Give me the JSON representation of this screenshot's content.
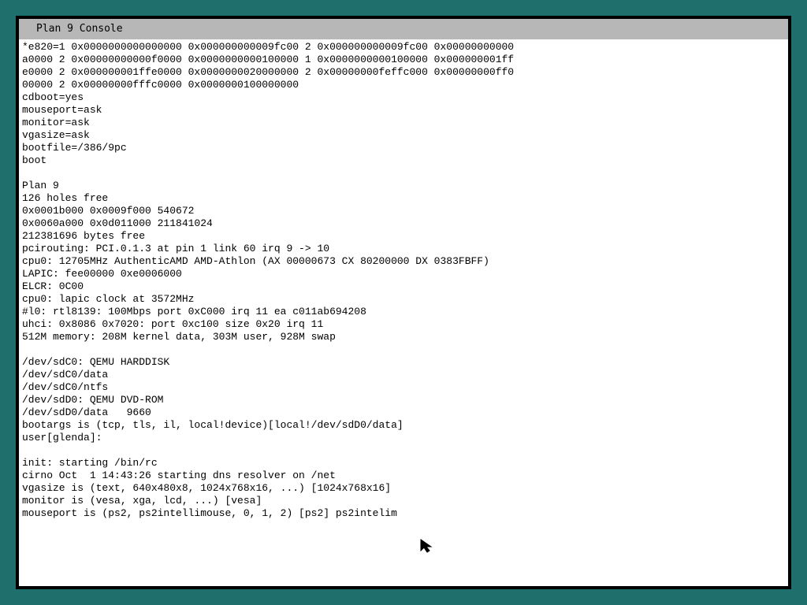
{
  "window": {
    "title": "Plan 9 Console"
  },
  "console": {
    "lines": [
      "*e820=1 0x0000000000000000 0x000000000009fc00 2 0x000000000009fc00 0x00000000000",
      "a0000 2 0x00000000000f0000 0x0000000000100000 1 0x0000000000100000 0x000000001ff",
      "e0000 2 0x000000001ffe0000 0x0000000020000000 2 0x00000000feffc000 0x00000000ff0",
      "00000 2 0x00000000fffc0000 0x0000000100000000",
      "cdboot=yes",
      "mouseport=ask",
      "monitor=ask",
      "vgasize=ask",
      "bootfile=/386/9pc",
      "boot",
      "",
      "Plan 9",
      "126 holes free",
      "0x0001b000 0x0009f000 540672",
      "0x0060a000 0x0d011000 211841024",
      "212381696 bytes free",
      "pcirouting: PCI.0.1.3 at pin 1 link 60 irq 9 -> 10",
      "cpu0: 12705MHz AuthenticAMD AMD-Athlon (AX 00000673 CX 80200000 DX 0383FBFF)",
      "LAPIC: fee00000 0xe0006000",
      "ELCR: 0C00",
      "cpu0: lapic clock at 3572MHz",
      "#l0: rtl8139: 100Mbps port 0xC000 irq 11 ea c011ab694208",
      "uhci: 0x8086 0x7020: port 0xc100 size 0x20 irq 11",
      "512M memory: 208M kernel data, 303M user, 928M swap",
      "",
      "/dev/sdC0: QEMU HARDDISK",
      "/dev/sdC0/data",
      "/dev/sdC0/ntfs",
      "/dev/sdD0: QEMU DVD-ROM",
      "/dev/sdD0/data   9660",
      "bootargs is (tcp, tls, il, local!device)[local!/dev/sdD0/data]",
      "user[glenda]:",
      "",
      "init: starting /bin/rc",
      "cirno Oct  1 14:43:26 starting dns resolver on /net",
      "vgasize is (text, 640x480x8, 1024x768x16, ...) [1024x768x16]",
      "monitor is (vesa, xga, lcd, ...) [vesa]",
      "mouseport is (ps2, ps2intellimouse, 0, 1, 2) [ps2] ps2intelim"
    ]
  },
  "icons": {
    "cursor": "mouse-pointer-icon"
  },
  "colors": {
    "desktop": "#1f6f6c",
    "titlebar": "#b7b7b7",
    "console_bg": "#ffffff",
    "text": "#000000"
  }
}
